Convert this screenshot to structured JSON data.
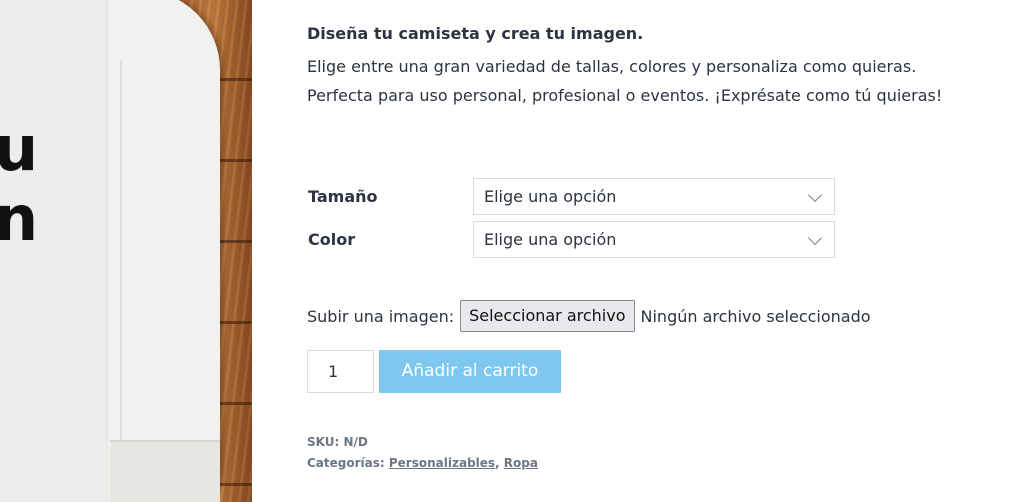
{
  "product_image": {
    "shirt_text_line1": "u",
    "shirt_text_line2": "n"
  },
  "product": {
    "title": "Diseña tu camiseta y crea tu imagen.",
    "description": "Elige entre una gran variedad de tallas, colores y personaliza como quieras. Perfecta para uso personal, profesional o eventos. ¡Exprésate como tú quieras!"
  },
  "variations": {
    "size_label": "Tamaño",
    "size_value": "Elige una opción",
    "color_label": "Color",
    "color_value": "Elige una opción"
  },
  "upload": {
    "label": "Subir una imagen:",
    "button": "Seleccionar archivo",
    "status": "Ningún archivo seleccionado"
  },
  "cart": {
    "quantity": "1",
    "add_button": "Añadir al carrito",
    "button_color": "#7ec8f0"
  },
  "meta": {
    "sku_label": "SKU:",
    "sku_value": "N/D",
    "categories_label": "Categorías:",
    "categories": [
      "Personalizables",
      "Ropa"
    ],
    "separator": ","
  }
}
